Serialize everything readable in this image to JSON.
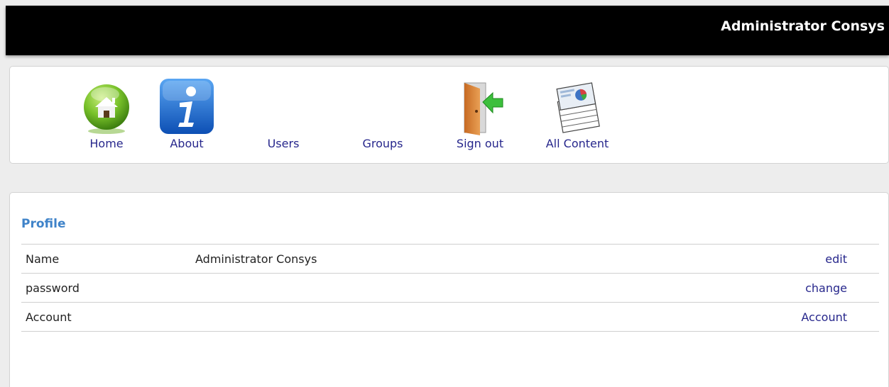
{
  "header": {
    "user_name": "Administrator Consys"
  },
  "nav": {
    "items": [
      {
        "label": "Home",
        "icon": "home-icon"
      },
      {
        "label": "About",
        "icon": "info-icon"
      },
      {
        "label": "Users"
      },
      {
        "label": "Groups"
      },
      {
        "label": "Sign out",
        "icon": "sign-out-icon"
      },
      {
        "label": "All Content",
        "icon": "documents-icon"
      }
    ]
  },
  "profile": {
    "title": "Profile",
    "rows": [
      {
        "key": "Name",
        "value": "Administrator Consys",
        "action": "edit"
      },
      {
        "key": "password",
        "value": "",
        "action": "change"
      },
      {
        "key": "Account",
        "value": "",
        "action": "Account"
      }
    ]
  },
  "colors": {
    "topbar": "#000000",
    "link": "#27278c",
    "profile_title": "#3f83c9"
  }
}
